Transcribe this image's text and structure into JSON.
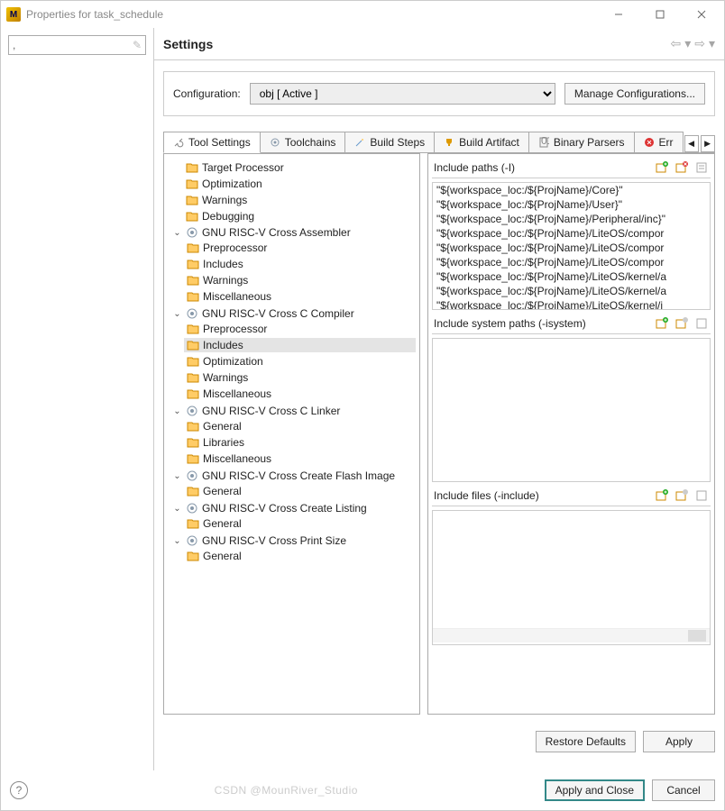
{
  "window": {
    "title": "Properties for task_schedule"
  },
  "filter": {
    "value": ","
  },
  "header": {
    "title": "Settings"
  },
  "config": {
    "label": "Configuration:",
    "selected": "obj  [ Active ]",
    "manage": "Manage Configurations..."
  },
  "tabs": {
    "tool_settings": "Tool Settings",
    "toolchains": "Toolchains",
    "build_steps": "Build Steps",
    "build_artifact": "Build Artifact",
    "binary_parsers": "Binary Parsers",
    "error": "Err"
  },
  "tree": {
    "target_processor": "Target Processor",
    "optimization": "Optimization",
    "warnings": "Warnings",
    "debugging": "Debugging",
    "asm": "GNU RISC-V Cross Assembler",
    "asm_preproc": "Preprocessor",
    "asm_includes": "Includes",
    "asm_warnings": "Warnings",
    "asm_misc": "Miscellaneous",
    "cc": "GNU RISC-V Cross C Compiler",
    "cc_preproc": "Preprocessor",
    "cc_includes": "Includes",
    "cc_opt": "Optimization",
    "cc_warnings": "Warnings",
    "cc_misc": "Miscellaneous",
    "ld": "GNU RISC-V Cross C Linker",
    "ld_general": "General",
    "ld_libs": "Libraries",
    "ld_misc": "Miscellaneous",
    "flash": "GNU RISC-V Cross Create Flash Image",
    "flash_general": "General",
    "listing": "GNU RISC-V Cross Create Listing",
    "listing_general": "General",
    "size": "GNU RISC-V Cross Print Size",
    "size_general": "General"
  },
  "sections": {
    "include_paths": "Include paths (-I)",
    "include_system": "Include system paths (-isystem)",
    "include_files": "Include files (-include)"
  },
  "paths": [
    "\"${workspace_loc:/${ProjName}/Core}\"",
    "\"${workspace_loc:/${ProjName}/User}\"",
    "\"${workspace_loc:/${ProjName}/Peripheral/inc}\"",
    "\"${workspace_loc:/${ProjName}/LiteOS/compor",
    "\"${workspace_loc:/${ProjName}/LiteOS/compor",
    "\"${workspace_loc:/${ProjName}/LiteOS/compor",
    "\"${workspace_loc:/${ProjName}/LiteOS/kernel/a",
    "\"${workspace_loc:/${ProjName}/LiteOS/kernel/a",
    "\"${workspace_loc:/${ProjName}/LiteOS/kernel/i"
  ],
  "buttons": {
    "restore": "Restore Defaults",
    "apply": "Apply",
    "apply_close": "Apply and Close",
    "cancel": "Cancel"
  },
  "watermark": "CSDN @MounRiver_Studio"
}
